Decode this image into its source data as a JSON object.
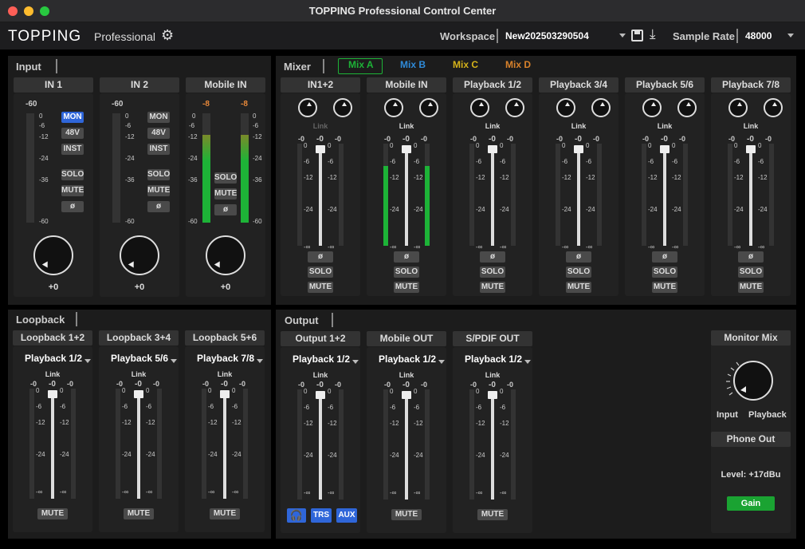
{
  "window": {
    "title": "TOPPING Professional Control Center"
  },
  "toolbar": {
    "logo": "TOPPING",
    "logo_sub": "Professional",
    "workspace_label": "Workspace",
    "workspace_value": "New202503290504",
    "sample_rate_label": "Sample Rate",
    "sample_rate_value": "48000"
  },
  "input": {
    "title": "Input",
    "channels": [
      {
        "name": "IN 1",
        "peak": "-60",
        "gain": "+0",
        "buttons": [
          "MON",
          "48V",
          "INST",
          "SOLO",
          "MUTE",
          "ø"
        ]
      },
      {
        "name": "IN 2",
        "peak": "-60",
        "gain": "+0",
        "buttons": [
          "MON",
          "48V",
          "INST",
          "SOLO",
          "MUTE",
          "ø"
        ]
      },
      {
        "name": "Mobile IN",
        "peak_l": "-8",
        "peak_r": "-8",
        "gain": "+0",
        "buttons": [
          "SOLO",
          "MUTE",
          "ø"
        ]
      }
    ],
    "scale": [
      "0",
      "-6",
      "-12",
      "-24",
      "-36",
      "-60"
    ]
  },
  "mixer": {
    "title": "Mixer",
    "tabs": [
      {
        "label": "Mix A",
        "color": "#1db337"
      },
      {
        "label": "Mix B",
        "color": "#2f8bd9"
      },
      {
        "label": "Mix C",
        "color": "#d4b21a"
      },
      {
        "label": "Mix D",
        "color": "#d9822b"
      }
    ],
    "channels": [
      "IN1+2",
      "Mobile IN",
      "Playback 1/2",
      "Playback 3/4",
      "Playback 5/6",
      "Playback 7/8"
    ],
    "link_label": "Link",
    "fader_value": "-0",
    "scale": [
      "0",
      "-6",
      "-12",
      "-24",
      "-∞"
    ],
    "buttons": [
      "ø",
      "SOLO",
      "MUTE"
    ]
  },
  "loopback": {
    "title": "Loopback",
    "channels": [
      {
        "name": "Loopback 1+2",
        "source": "Playback 1/2"
      },
      {
        "name": "Loopback 3+4",
        "source": "Playback 5/6"
      },
      {
        "name": "Loopback 5+6",
        "source": "Playback 7/8"
      }
    ],
    "mute": "MUTE"
  },
  "output": {
    "title": "Output",
    "channels": [
      {
        "name": "Output 1+2",
        "source": "Playback 1/2"
      },
      {
        "name": "Mobile OUT",
        "source": "Playback 1/2"
      },
      {
        "name": "S/PDIF OUT",
        "source": "Playback 1/2"
      }
    ],
    "out_buttons": [
      "TRS",
      "AUX"
    ],
    "mute": "MUTE",
    "monitor_mix": {
      "title": "Monitor Mix",
      "left": "Input",
      "right": "Playback"
    },
    "phone_out": {
      "title": "Phone Out",
      "level": "Level: +17dBu",
      "gain_button": "Gain"
    }
  }
}
